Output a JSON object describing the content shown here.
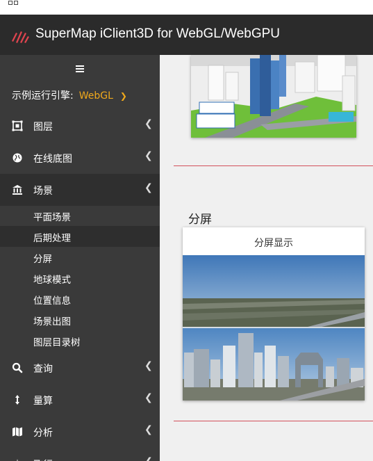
{
  "header": {
    "title": "SuperMap iClient3D for WebGL/WebGPU"
  },
  "sidebar": {
    "engine_label": "示例运行引擎:",
    "engine_value": "WebGL",
    "items": [
      {
        "label": "图层",
        "icon": "layers-icon"
      },
      {
        "label": "在线底图",
        "icon": "globe-icon"
      },
      {
        "label": "场景",
        "icon": "bank-icon"
      },
      {
        "label": "查询",
        "icon": "search-icon"
      },
      {
        "label": "量算",
        "icon": "arrows-vertical-icon"
      },
      {
        "label": "分析",
        "icon": "map-icon"
      },
      {
        "label": "飞行",
        "icon": "plane-icon"
      }
    ],
    "sub_items": [
      {
        "label": "平面场景"
      },
      {
        "label": "后期处理"
      },
      {
        "label": "分屏"
      },
      {
        "label": "地球模式"
      },
      {
        "label": "位置信息"
      },
      {
        "label": "场景出图"
      },
      {
        "label": "图层目录树"
      }
    ]
  },
  "main": {
    "section_title": "分屏",
    "card_caption": "分屏显示"
  },
  "colors": {
    "accent": "#f0a91c",
    "divider": "#d2505b",
    "logo": "#e0444f"
  }
}
